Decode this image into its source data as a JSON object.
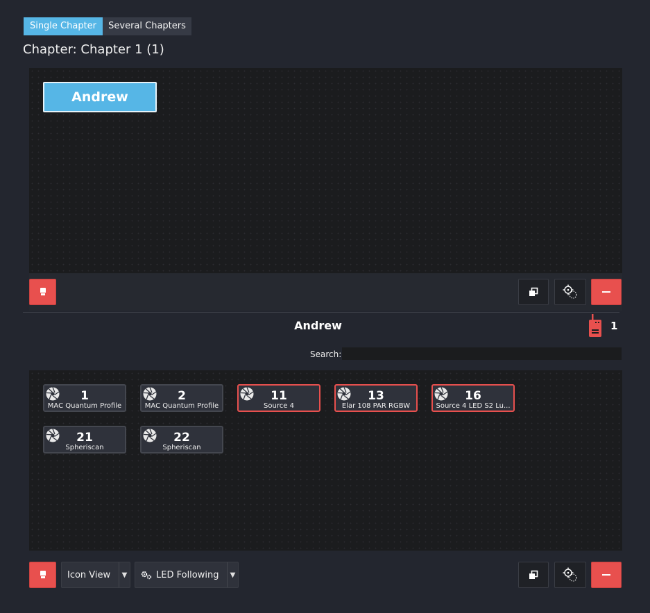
{
  "tabs": [
    {
      "label": "Single Chapter",
      "active": true
    },
    {
      "label": "Several Chapters",
      "active": false
    }
  ],
  "chapter_title": "Chapter: Chapter 1 (1)",
  "group_button_label": "Andrew",
  "selected_group": {
    "title": "Andrew",
    "count": "1"
  },
  "search": {
    "label": "Search:",
    "value": "",
    "placeholder": ""
  },
  "fixtures": [
    {
      "id": "1",
      "name": "MAC Quantum Profile",
      "alert": false
    },
    {
      "id": "2",
      "name": "MAC Quantum Profile",
      "alert": false
    },
    {
      "id": "11",
      "name": "Source 4",
      "alert": true
    },
    {
      "id": "13",
      "name": "Elar 108 PAR RGBW",
      "alert": true
    },
    {
      "id": "16",
      "name": "Source 4 LED S2 Lu...",
      "alert": true
    },
    {
      "id": "21",
      "name": "Spheriscan",
      "alert": false
    },
    {
      "id": "22",
      "name": "Spheriscan",
      "alert": false
    }
  ],
  "bottom_toolbar": {
    "view_mode": "Icon View",
    "led_mode": "LED Following"
  },
  "icons": {
    "lock": "lock-icon",
    "window": "restore-window-icon",
    "target": "locate-target-icon",
    "remove": "minus-icon",
    "walkie": "walkie-talkie-icon",
    "aperture": "aperture-icon",
    "gear": "gears-icon"
  },
  "colors": {
    "accent": "#56b6e6",
    "danger": "#e8504e",
    "background": "#23262f",
    "panel": "#1b1c1e",
    "tile": "#2f323b"
  }
}
